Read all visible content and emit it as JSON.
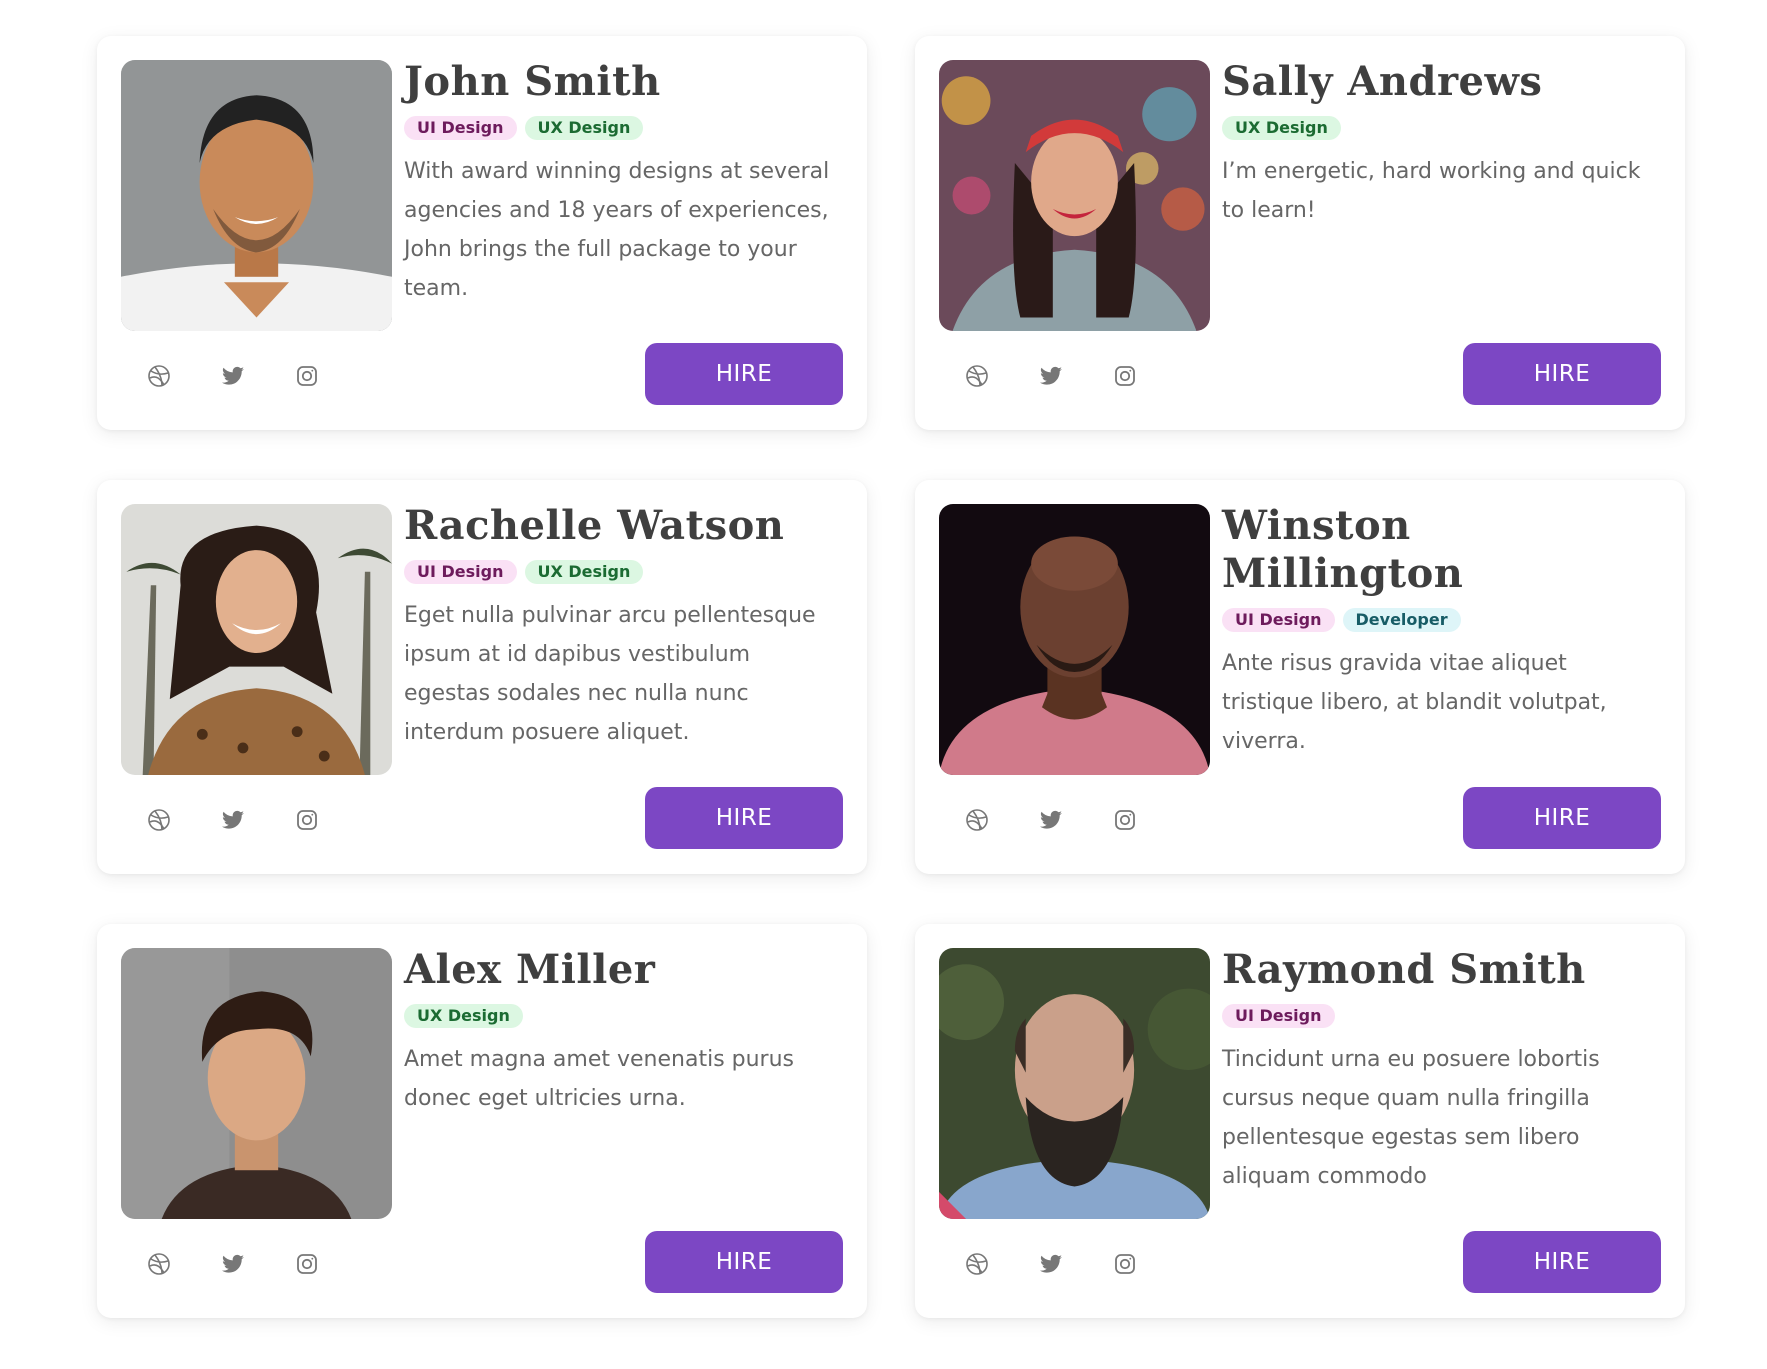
{
  "accent_color": "#7c47c4",
  "tag_colors": {
    "ui": {
      "bg": "#fae1f5",
      "text": "#6d1b5c"
    },
    "ux": {
      "bg": "#dcf7e2",
      "text": "#1b6b32"
    },
    "dev": {
      "bg": "#def5f8",
      "text": "#175c66"
    }
  },
  "social_icons": [
    "dribbble-icon",
    "twitter-icon",
    "instagram-icon"
  ],
  "cards": [
    {
      "name": "John Smith",
      "tags": [
        {
          "label": "UI Design",
          "kind": "ui"
        },
        {
          "label": "UX Design",
          "kind": "ux"
        }
      ],
      "bio": "With award winning designs at several agencies and 18 years of experiences, John brings the full package to your team.",
      "hire_label": "HIRE"
    },
    {
      "name": "Sally Andrews",
      "tags": [
        {
          "label": "UX Design",
          "kind": "ux"
        }
      ],
      "bio": "I’m energetic, hard working and quick to learn!",
      "hire_label": "HIRE"
    },
    {
      "name": "Rachelle Watson",
      "tags": [
        {
          "label": "UI Design",
          "kind": "ui"
        },
        {
          "label": "UX Design",
          "kind": "ux"
        }
      ],
      "bio": "Eget nulla pulvinar arcu pellentesque ipsum at id dapibus vestibulum egestas sodales nec nulla nunc interdum posuere aliquet.",
      "hire_label": "HIRE"
    },
    {
      "name": "Winston Millington",
      "tags": [
        {
          "label": "UI Design",
          "kind": "ui"
        },
        {
          "label": "Developer",
          "kind": "dev"
        }
      ],
      "bio": "Ante risus gravida vitae aliquet tristique libero, at blandit volutpat, viverra.",
      "hire_label": "HIRE"
    },
    {
      "name": "Alex Miller",
      "tags": [
        {
          "label": "UX Design",
          "kind": "ux"
        }
      ],
      "bio": "Amet magna amet venenatis purus donec eget ultricies urna.",
      "hire_label": "HIRE"
    },
    {
      "name": "Raymond Smith",
      "tags": [
        {
          "label": "UI Design",
          "kind": "ui"
        }
      ],
      "bio": "Tincidunt urna eu posuere lobortis cursus neque quam nulla fringilla pellentesque egestas sem libero aliquam commodo",
      "hire_label": "HIRE"
    }
  ]
}
